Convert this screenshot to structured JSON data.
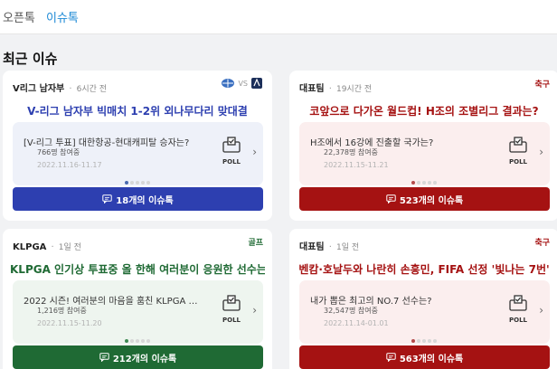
{
  "nav": {
    "tabs": [
      {
        "label": "오픈톡"
      },
      {
        "label": "이슈톡"
      }
    ]
  },
  "section_title": "최근 이슈",
  "cards": [
    {
      "topic": "V리그 남자부",
      "dot": "·",
      "time": "6시간 전",
      "category": "",
      "vs": "VS",
      "headline": "V-리그 남자부 빅매치 1-2위 외나무다리 맞대결",
      "poll_question": "[V-리그 투표] 대한항공-현대캐피탈 승자는?",
      "participants": "766명 참여중",
      "date_range": "2022.11.16-11.17",
      "poll_label": "POLL",
      "cta": "18개의 이슈톡",
      "colors": {
        "accent": "#2d3fb0",
        "poll_bg": "#eef1f9",
        "dot_on": "#4a6ab0"
      }
    },
    {
      "topic": "대표팀",
      "dot": "·",
      "time": "19시간 전",
      "category": "축구",
      "headline": "코앞으로 다가온 월드컵! H조의 조별리그 결과는?",
      "poll_question": "H조에서 16강에 진출할 국가는?",
      "participants": "22,378명 참여중",
      "date_range": "2022.11.15-11.21",
      "poll_label": "POLL",
      "cta": "523개의 이슈톡",
      "colors": {
        "accent": "#a51212",
        "poll_bg": "#fbeeee",
        "dot_on": "#b44a4a"
      }
    },
    {
      "topic": "KLPGA",
      "dot": "·",
      "time": "1일 전",
      "category": "골프",
      "headline": "KLPGA 인기상 투표중 올 한해 여러분이 응원한 선수는?",
      "poll_question": "2022 시즌! 여러분의 마음을 훔친 KLPGA 선수를 투표...",
      "participants": "1,216명 참여중",
      "date_range": "2022.11.15-11.20",
      "poll_label": "POLL",
      "cta": "212개의 이슈톡",
      "colors": {
        "accent": "#1f6a34",
        "poll_bg": "#eef5ef",
        "dot_on": "#3f8b55"
      }
    },
    {
      "topic": "대표팀",
      "dot": "·",
      "time": "1일 전",
      "category": "축구",
      "headline": "벤캄·호날두와 나란히 손흥민, FIFA 선정 '빛나는 7번'",
      "poll_question": "내가 뽑은 최고의 NO.7 선수는?",
      "participants": "32,547명 참여중",
      "date_range": "2022.11.14-01.01",
      "poll_label": "POLL",
      "cta": "563개의 이슈톡",
      "colors": {
        "accent": "#a51212",
        "poll_bg": "#fbeeee",
        "dot_on": "#b44a4a"
      }
    }
  ]
}
